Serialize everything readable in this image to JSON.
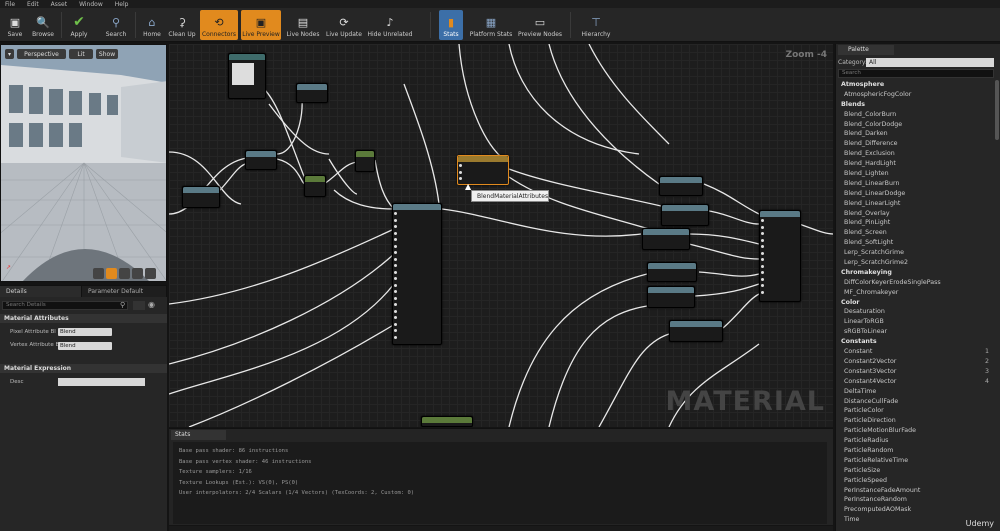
{
  "menu": [
    "File",
    "Edit",
    "Asset",
    "Window",
    "Help"
  ],
  "toolbar": {
    "save": "Save",
    "browse": "Browse",
    "apply": "Apply",
    "search": "Search",
    "home": "Home",
    "cleanup": "Clean Up",
    "connectors": "Connectors",
    "live_preview": "Live Preview",
    "live_nodes": "Live Nodes",
    "live_update": "Live Update",
    "hide_unrelated": "Hide Unrelated",
    "stats": "Stats",
    "platform_stats": "Platform Stats",
    "preview_nodes": "Preview Nodes",
    "hierarchy": "Hierarchy"
  },
  "viewport": {
    "perspective": "Perspective",
    "lit": "Lit",
    "show": "Show"
  },
  "details": {
    "tab1": "Details",
    "tab2": "Parameter Default",
    "search_placeholder": "Search Details",
    "section1": "Material Attributes",
    "prop1_label": "Pixel Attribute Bl",
    "prop1_value": "Blend",
    "prop2_label": "Vertex Attribute B",
    "prop2_value": "Blend",
    "section2": "Material Expression",
    "desc_label": "Desc"
  },
  "graph": {
    "zoom": "Zoom -4",
    "watermark": "MATERIAL",
    "tooltip": "BlendMaterialAttributes"
  },
  "stats": {
    "tab": "Stats",
    "lines": [
      "Base pass shader: 86 instructions",
      "Base pass vertex shader: 46 instructions",
      "Texture samplers: 1/16",
      "Texture Lookups (Est.): VS(0), PS(0)",
      "User interpolators: 2/4 Scalars (1/4 Vectors) (TexCoords: 2, Custom: 0)"
    ]
  },
  "palette": {
    "tab": "Palette",
    "category_label": "Category:",
    "category_value": "All",
    "search_placeholder": "Search",
    "items": [
      {
        "label": "Atmosphere",
        "cat": true,
        "hk": ""
      },
      {
        "label": "AtmosphericFogColor",
        "cat": false,
        "hk": ""
      },
      {
        "label": "Blends",
        "cat": true,
        "hk": ""
      },
      {
        "label": "Blend_ColorBurn",
        "cat": false,
        "hk": ""
      },
      {
        "label": "Blend_ColorDodge",
        "cat": false,
        "hk": ""
      },
      {
        "label": "Blend_Darken",
        "cat": false,
        "hk": ""
      },
      {
        "label": "Blend_Difference",
        "cat": false,
        "hk": ""
      },
      {
        "label": "Blend_Exclusion",
        "cat": false,
        "hk": ""
      },
      {
        "label": "Blend_HardLight",
        "cat": false,
        "hk": ""
      },
      {
        "label": "Blend_Lighten",
        "cat": false,
        "hk": ""
      },
      {
        "label": "Blend_LinearBurn",
        "cat": false,
        "hk": ""
      },
      {
        "label": "Blend_LinearDodge",
        "cat": false,
        "hk": ""
      },
      {
        "label": "Blend_LinearLight",
        "cat": false,
        "hk": ""
      },
      {
        "label": "Blend_Overlay",
        "cat": false,
        "hk": ""
      },
      {
        "label": "Blend_PinLight",
        "cat": false,
        "hk": ""
      },
      {
        "label": "Blend_Screen",
        "cat": false,
        "hk": ""
      },
      {
        "label": "Blend_SoftLight",
        "cat": false,
        "hk": ""
      },
      {
        "label": "Lerp_ScratchGrime",
        "cat": false,
        "hk": ""
      },
      {
        "label": "Lerp_ScratchGrime2",
        "cat": false,
        "hk": ""
      },
      {
        "label": "Chromakeying",
        "cat": true,
        "hk": ""
      },
      {
        "label": "DiffColorKeyerErodeSinglePass",
        "cat": false,
        "hk": ""
      },
      {
        "label": "MF_Chromakeyer",
        "cat": false,
        "hk": ""
      },
      {
        "label": "Color",
        "cat": true,
        "hk": ""
      },
      {
        "label": "Desaturation",
        "cat": false,
        "hk": ""
      },
      {
        "label": "LinearToRGB",
        "cat": false,
        "hk": ""
      },
      {
        "label": "sRGBToLinear",
        "cat": false,
        "hk": ""
      },
      {
        "label": "Constants",
        "cat": true,
        "hk": ""
      },
      {
        "label": "Constant",
        "cat": false,
        "hk": "1"
      },
      {
        "label": "Constant2Vector",
        "cat": false,
        "hk": "2"
      },
      {
        "label": "Constant3Vector",
        "cat": false,
        "hk": "3"
      },
      {
        "label": "Constant4Vector",
        "cat": false,
        "hk": "4"
      },
      {
        "label": "DeltaTime",
        "cat": false,
        "hk": ""
      },
      {
        "label": "DistanceCullFade",
        "cat": false,
        "hk": ""
      },
      {
        "label": "ParticleColor",
        "cat": false,
        "hk": ""
      },
      {
        "label": "ParticleDirection",
        "cat": false,
        "hk": ""
      },
      {
        "label": "ParticleMotionBlurFade",
        "cat": false,
        "hk": ""
      },
      {
        "label": "ParticleRadius",
        "cat": false,
        "hk": ""
      },
      {
        "label": "ParticleRandom",
        "cat": false,
        "hk": ""
      },
      {
        "label": "ParticleRelativeTime",
        "cat": false,
        "hk": ""
      },
      {
        "label": "ParticleSize",
        "cat": false,
        "hk": ""
      },
      {
        "label": "ParticleSpeed",
        "cat": false,
        "hk": ""
      },
      {
        "label": "PerInstanceFadeAmount",
        "cat": false,
        "hk": ""
      },
      {
        "label": "PerInstanceRandom",
        "cat": false,
        "hk": ""
      },
      {
        "label": "PrecomputedAOMask",
        "cat": false,
        "hk": ""
      },
      {
        "label": "Time",
        "cat": false,
        "hk": ""
      }
    ]
  },
  "watermark_brand": "Udemy"
}
